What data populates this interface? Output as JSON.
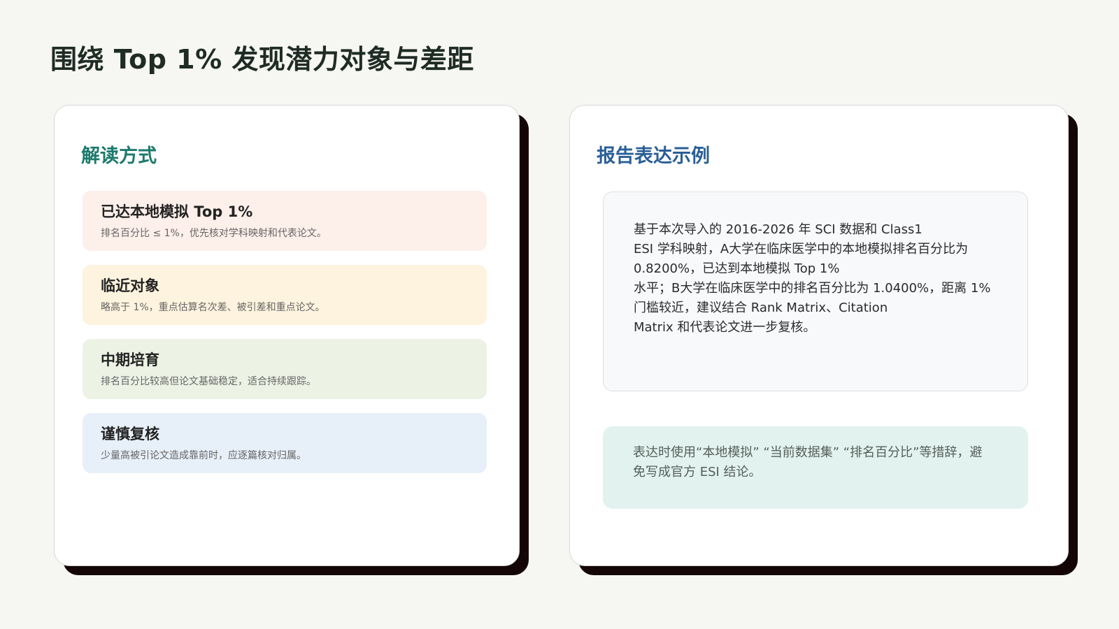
{
  "page": {
    "title": "围绕 Top 1% 发现潜力对象与差距"
  },
  "interpretation": {
    "heading": "解读方式",
    "items": [
      {
        "title": "已达本地模拟 Top 1%",
        "desc": "排名百分比 ≤ 1%，优先核对学科映射和代表论文。"
      },
      {
        "title": "临近对象",
        "desc": "略高于 1%，重点估算名次差、被引差和重点论文。"
      },
      {
        "title": "中期培育",
        "desc": "排名百分比较高但论文基础稳定，适合持续跟踪。"
      },
      {
        "title": "谨慎复核",
        "desc": "少量高被引论文造成靠前时，应逐篇核对归属。"
      }
    ]
  },
  "report": {
    "heading": "报告表达示例",
    "example_lines": [
      "基于本次导入的 2016-2026 年 SCI 数据和 Class1",
      "ESI 学科映射，A大学在临床医学中的本地模拟排名百分比为",
      "0.8200%，已达到本地模拟 Top 1%",
      "水平；B大学在临床医学中的排名百分比为 1.0400%，距离 1%",
      "门槛较近，建议结合 Rank Matrix、Citation",
      "Matrix 和代表论文进一步复核。"
    ],
    "note_lines": [
      "表达时使用“本地模拟” “当前数据集” “排名百分比”等措辞，避",
      "免写成官方 ESI 结论。"
    ]
  },
  "colors": {
    "background": "#f6f6f2",
    "interpretation_heading": "#1c7a6c",
    "report_heading": "#2a5f96",
    "item_1_bg": "#fdefea",
    "item_2_bg": "#fdf3de",
    "item_3_bg": "#ecf2e4",
    "item_4_bg": "#e7eff8",
    "note_bg": "#e2f2ee"
  }
}
